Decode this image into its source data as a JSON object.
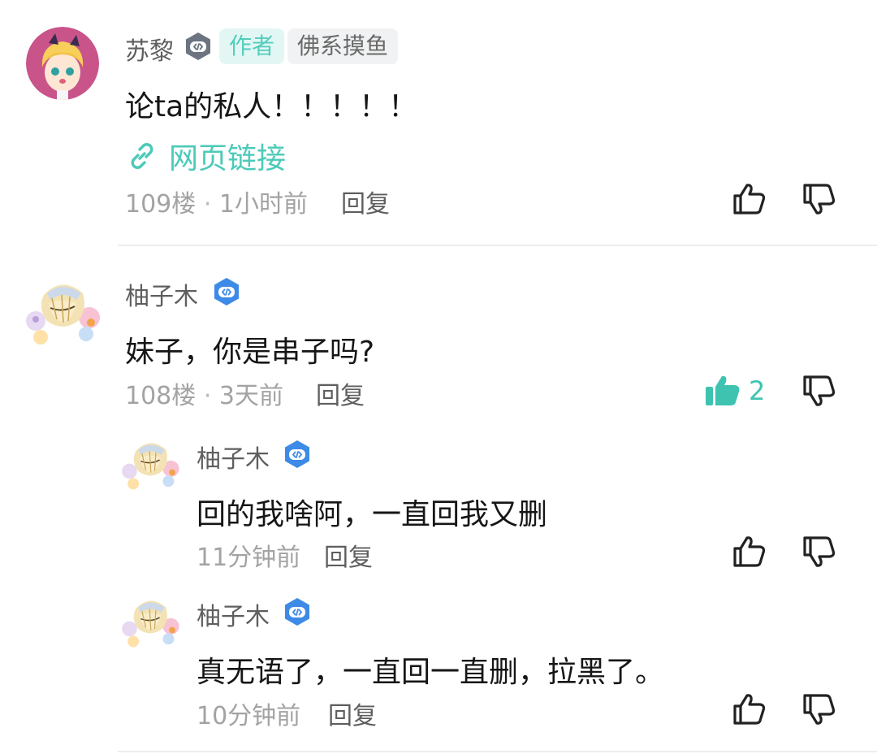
{
  "comments": [
    {
      "user": "苏黎",
      "tags": [
        "作者",
        "佛系摸鱼"
      ],
      "text": "论ta的私人！！！！！",
      "link_label": "网页链接",
      "floor": "109楼",
      "time": "1小时前",
      "reply_label": "回复"
    },
    {
      "user": "柚子木",
      "text": "妹子，你是串子吗?",
      "floor": "108楼",
      "time": "3天前",
      "reply_label": "回复",
      "like_count": "2",
      "replies": [
        {
          "user": "柚子木",
          "text": "回的我啥阿，一直回我又删",
          "time": "11分钟前",
          "reply_label": "回复"
        },
        {
          "user": "柚子木",
          "text": "真无语了，一直回一直删，拉黑了。",
          "time": "10分钟前",
          "reply_label": "回复"
        }
      ]
    }
  ],
  "separator": "·",
  "colors": {
    "accent": "#4ccab8",
    "badge_gray": "#6b7480",
    "badge_blue": "#3d8be6"
  },
  "icons": [
    "game-controller-badge-icon",
    "link-icon",
    "thumbs-up-icon",
    "thumbs-down-icon"
  ]
}
